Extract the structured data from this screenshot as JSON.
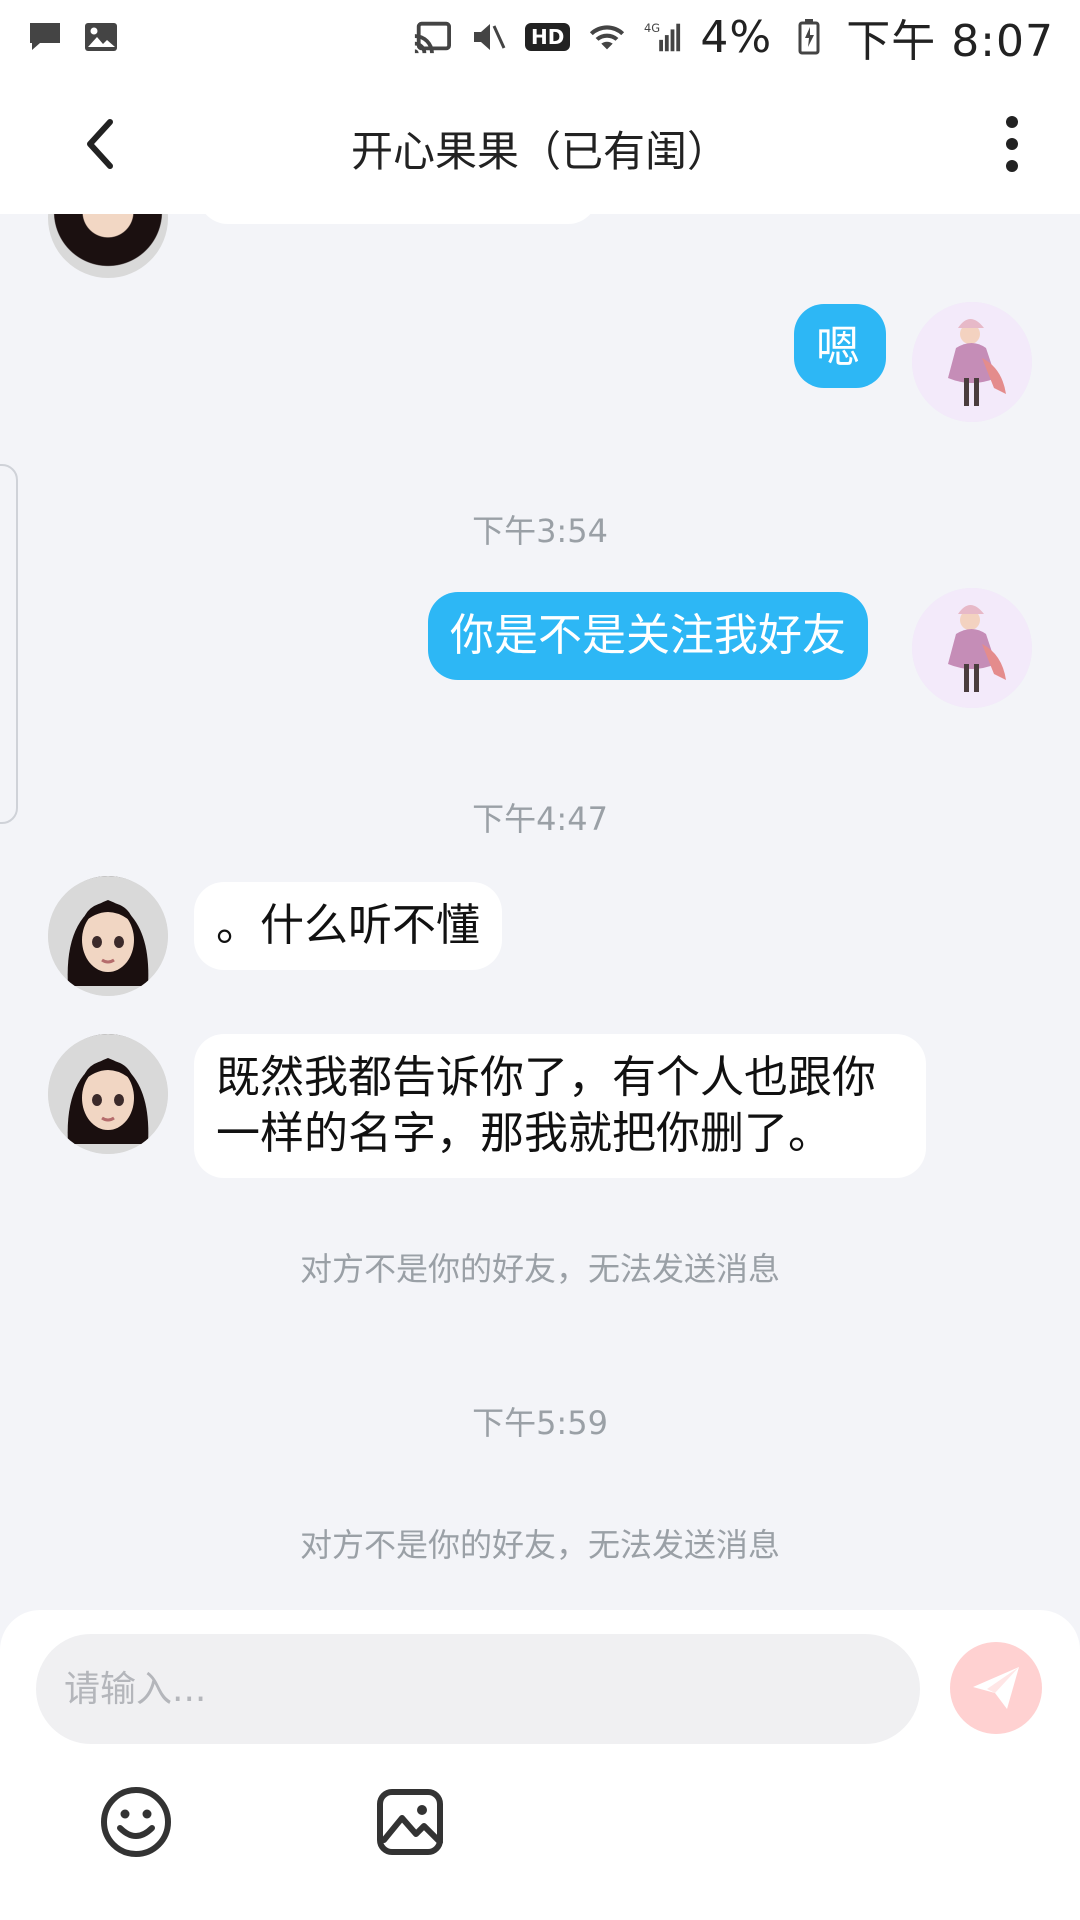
{
  "status_bar": {
    "time": "下午 8:07",
    "battery": "4%",
    "hd_label": "HD",
    "icons": [
      "message-icon",
      "image-icon",
      "cast-icon",
      "mute-icon",
      "wifi-icon",
      "signal-4g-icon",
      "battery-charging-icon"
    ]
  },
  "header": {
    "title": "开心果果（已有闺）",
    "icons": {
      "back": "chevron-left-icon",
      "more": "more-vertical-icon"
    }
  },
  "chat": {
    "messages": [
      {
        "side": "out",
        "text": "嗯"
      },
      {
        "time": "下午3:54"
      },
      {
        "side": "out",
        "text": "你是不是关注我好友"
      },
      {
        "time": "下午4:47"
      },
      {
        "side": "in",
        "text": "。什么听不懂"
      },
      {
        "side": "in",
        "text": "既然我都告诉你了，有个人也跟你一样的名字，那我就把你删了。"
      },
      {
        "system": "对方不是你的好友，无法发送消息"
      },
      {
        "time": "下午5:59"
      },
      {
        "system": "对方不是你的好友，无法发送消息"
      }
    ]
  },
  "composer": {
    "placeholder": "请输入...",
    "icons": {
      "send": "send-paper-plane-icon",
      "emoji": "emoji-smile-icon",
      "image": "image-picker-icon"
    }
  },
  "colors": {
    "outgoing_bubble": "#2db7f5",
    "incoming_bubble": "#ffffff",
    "background": "#f3f4f8",
    "system_text": "#9aa0a6",
    "send_button": "#ffd1d1"
  }
}
